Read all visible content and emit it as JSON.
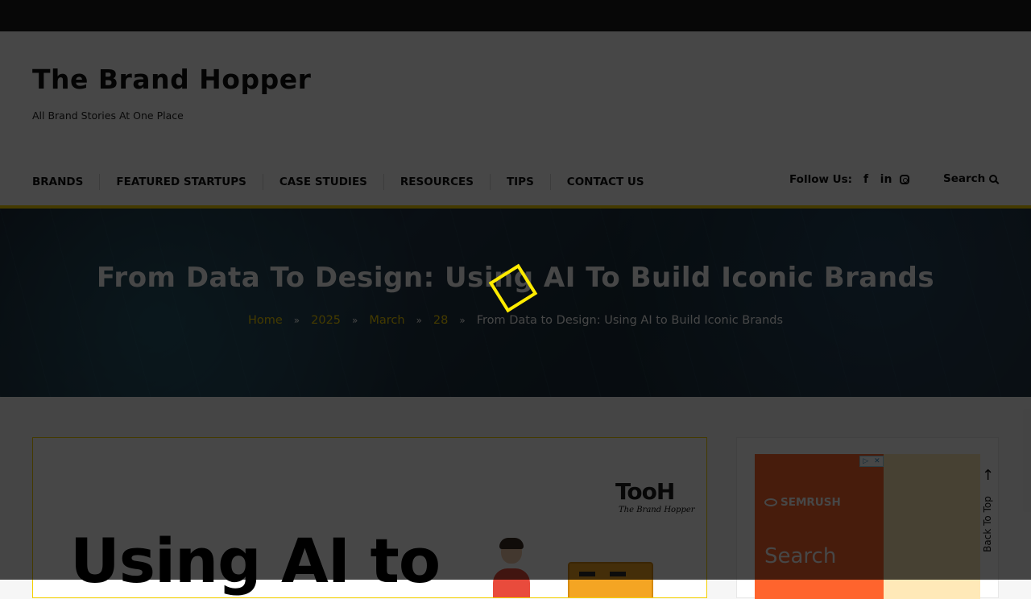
{
  "site": {
    "title": "The Brand Hopper",
    "tagline": "All Brand Stories At One Place"
  },
  "nav": {
    "items": [
      "BRANDS",
      "FEATURED STARTUPS",
      "CASE STUDIES",
      "RESOURCES",
      "TIPS",
      "CONTACT US"
    ],
    "follow_label": "Follow Us:",
    "social": [
      "facebook-icon",
      "linkedin-icon",
      "instagram-icon"
    ],
    "search_label": "Search"
  },
  "hero": {
    "title": "From Data To Design: Using AI To Build Iconic Brands",
    "breadcrumb": [
      "Home",
      "2025",
      "March",
      "28"
    ],
    "breadcrumb_current": "From Data to Design: Using AI to Build Iconic Brands"
  },
  "article": {
    "image_headline": "Using AI to",
    "logo_text": "TooH",
    "logo_sub": "The Brand Hopper"
  },
  "sidebar": {
    "ad_brand": "SEMRUSH",
    "ad_text": "Search"
  },
  "back_to_top": "Back To Top",
  "colors": {
    "accent": "#f4d000",
    "topbar": "#1a1a1a",
    "ad_orange": "#ff642d",
    "loader": "#ffeb00"
  }
}
